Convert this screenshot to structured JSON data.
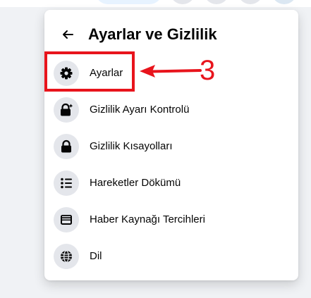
{
  "menu": {
    "title": "Ayarlar ve Gizlilik",
    "items": [
      {
        "label": "Ayarlar",
        "icon": "gear-icon"
      },
      {
        "label": "Gizlilik Ayarı Kontrolü",
        "icon": "lock-check-icon"
      },
      {
        "label": "Gizlilik Kısayolları",
        "icon": "lock-icon"
      },
      {
        "label": "Hareketler Dökümü",
        "icon": "list-icon"
      },
      {
        "label": "Haber Kaynağı Tercihleri",
        "icon": "news-feed-icon"
      },
      {
        "label": "Dil",
        "icon": "globe-icon"
      }
    ]
  },
  "annotation": {
    "number": "3",
    "color": "#e8141c"
  }
}
